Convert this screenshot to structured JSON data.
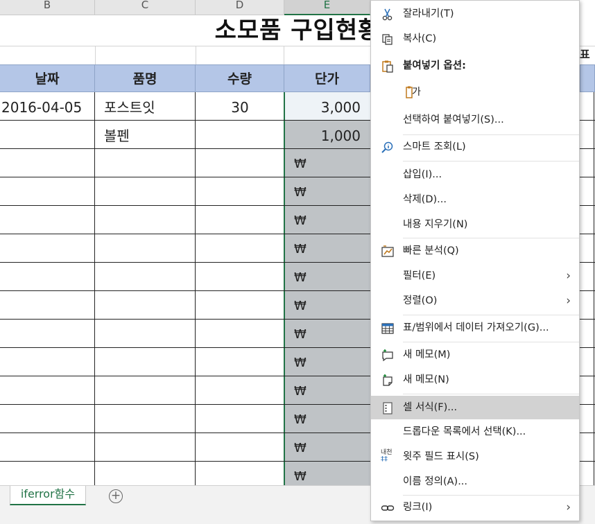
{
  "columns": [
    {
      "label": "B"
    },
    {
      "label": "C"
    },
    {
      "label": "D"
    },
    {
      "label": "E"
    }
  ],
  "title": "소모품 구입현황",
  "headers": [
    "날짜",
    "품명",
    "수량",
    "단가"
  ],
  "rows": [
    {
      "date": "2016-04-05",
      "item": "포스트잇",
      "qty": "30",
      "price": "3,000"
    },
    {
      "date": "",
      "item": "볼펜",
      "qty": "",
      "price": "1,000"
    }
  ],
  "currency_symbol": "₩",
  "partial_header_right": "표",
  "sheet_tab": "iferror함수",
  "add_sheet_symbol": "+",
  "context_menu": {
    "cut": "잘라내기(T)",
    "copy": "복사(C)",
    "paste_options": "붙여넣기 옵션:",
    "paste_icon_text": "가",
    "paste_special": "선택하여 붙여넣기(S)...",
    "smart_lookup": "스마트 조회(L)",
    "insert": "삽입(I)...",
    "delete": "삭제(D)...",
    "clear_contents": "내용 지우기(N)",
    "quick_analysis": "빠른 분석(Q)",
    "filter": "필터(E)",
    "sort": "정렬(O)",
    "get_data": "표/범위에서 데이터 가져오기(G)...",
    "new_comment": "새 메모(M)",
    "new_note": "새 메모(N)",
    "format_cells": "셀 서식(F)...",
    "pick_from_list": "드롭다운 목록에서 선택(K)...",
    "phonetic": "윗주 필드 표시(S)",
    "phonetic_icon_text": "내천",
    "define_name": "이름 정의(A)...",
    "link": "링크(I)",
    "submenu_arrow": "›"
  },
  "colors": {
    "header_fill": "#b4c6e7",
    "selection_fill": "#bfc3c6",
    "excel_green": "#217346",
    "menu_hover": "#d2d2d2"
  }
}
